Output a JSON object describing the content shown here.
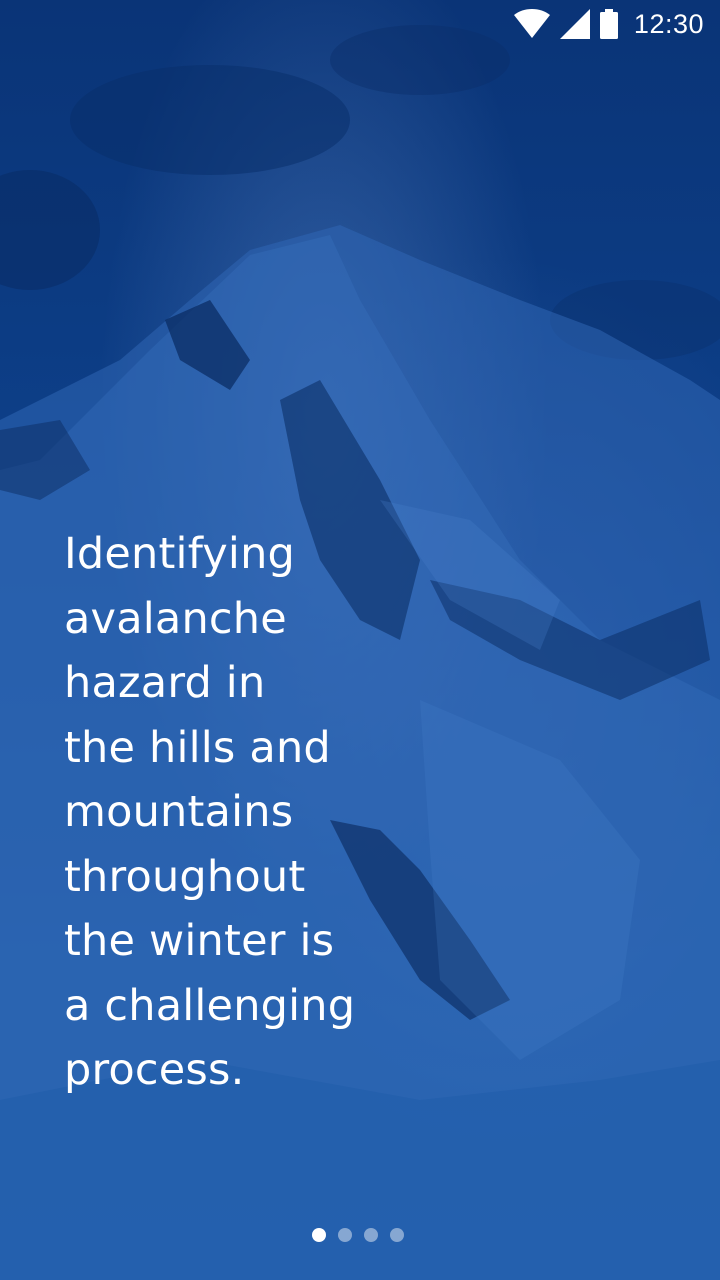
{
  "status_bar": {
    "time": "12:30",
    "icons": [
      "wifi-icon",
      "cellular-signal-icon",
      "battery-icon"
    ]
  },
  "onboarding": {
    "headline_lines": [
      "Identifying",
      "avalanche",
      "hazard in",
      "the hills and",
      "mountains",
      "throughout",
      "the winter is",
      "a challenging",
      "process."
    ],
    "page_indicator": {
      "total_pages": 4,
      "current_page": 1
    }
  },
  "colors": {
    "overlay": "#0d3f86",
    "text": "#ffffff",
    "dot_inactive": "rgba(255,255,255,0.45)",
    "dot_active": "#ffffff"
  }
}
